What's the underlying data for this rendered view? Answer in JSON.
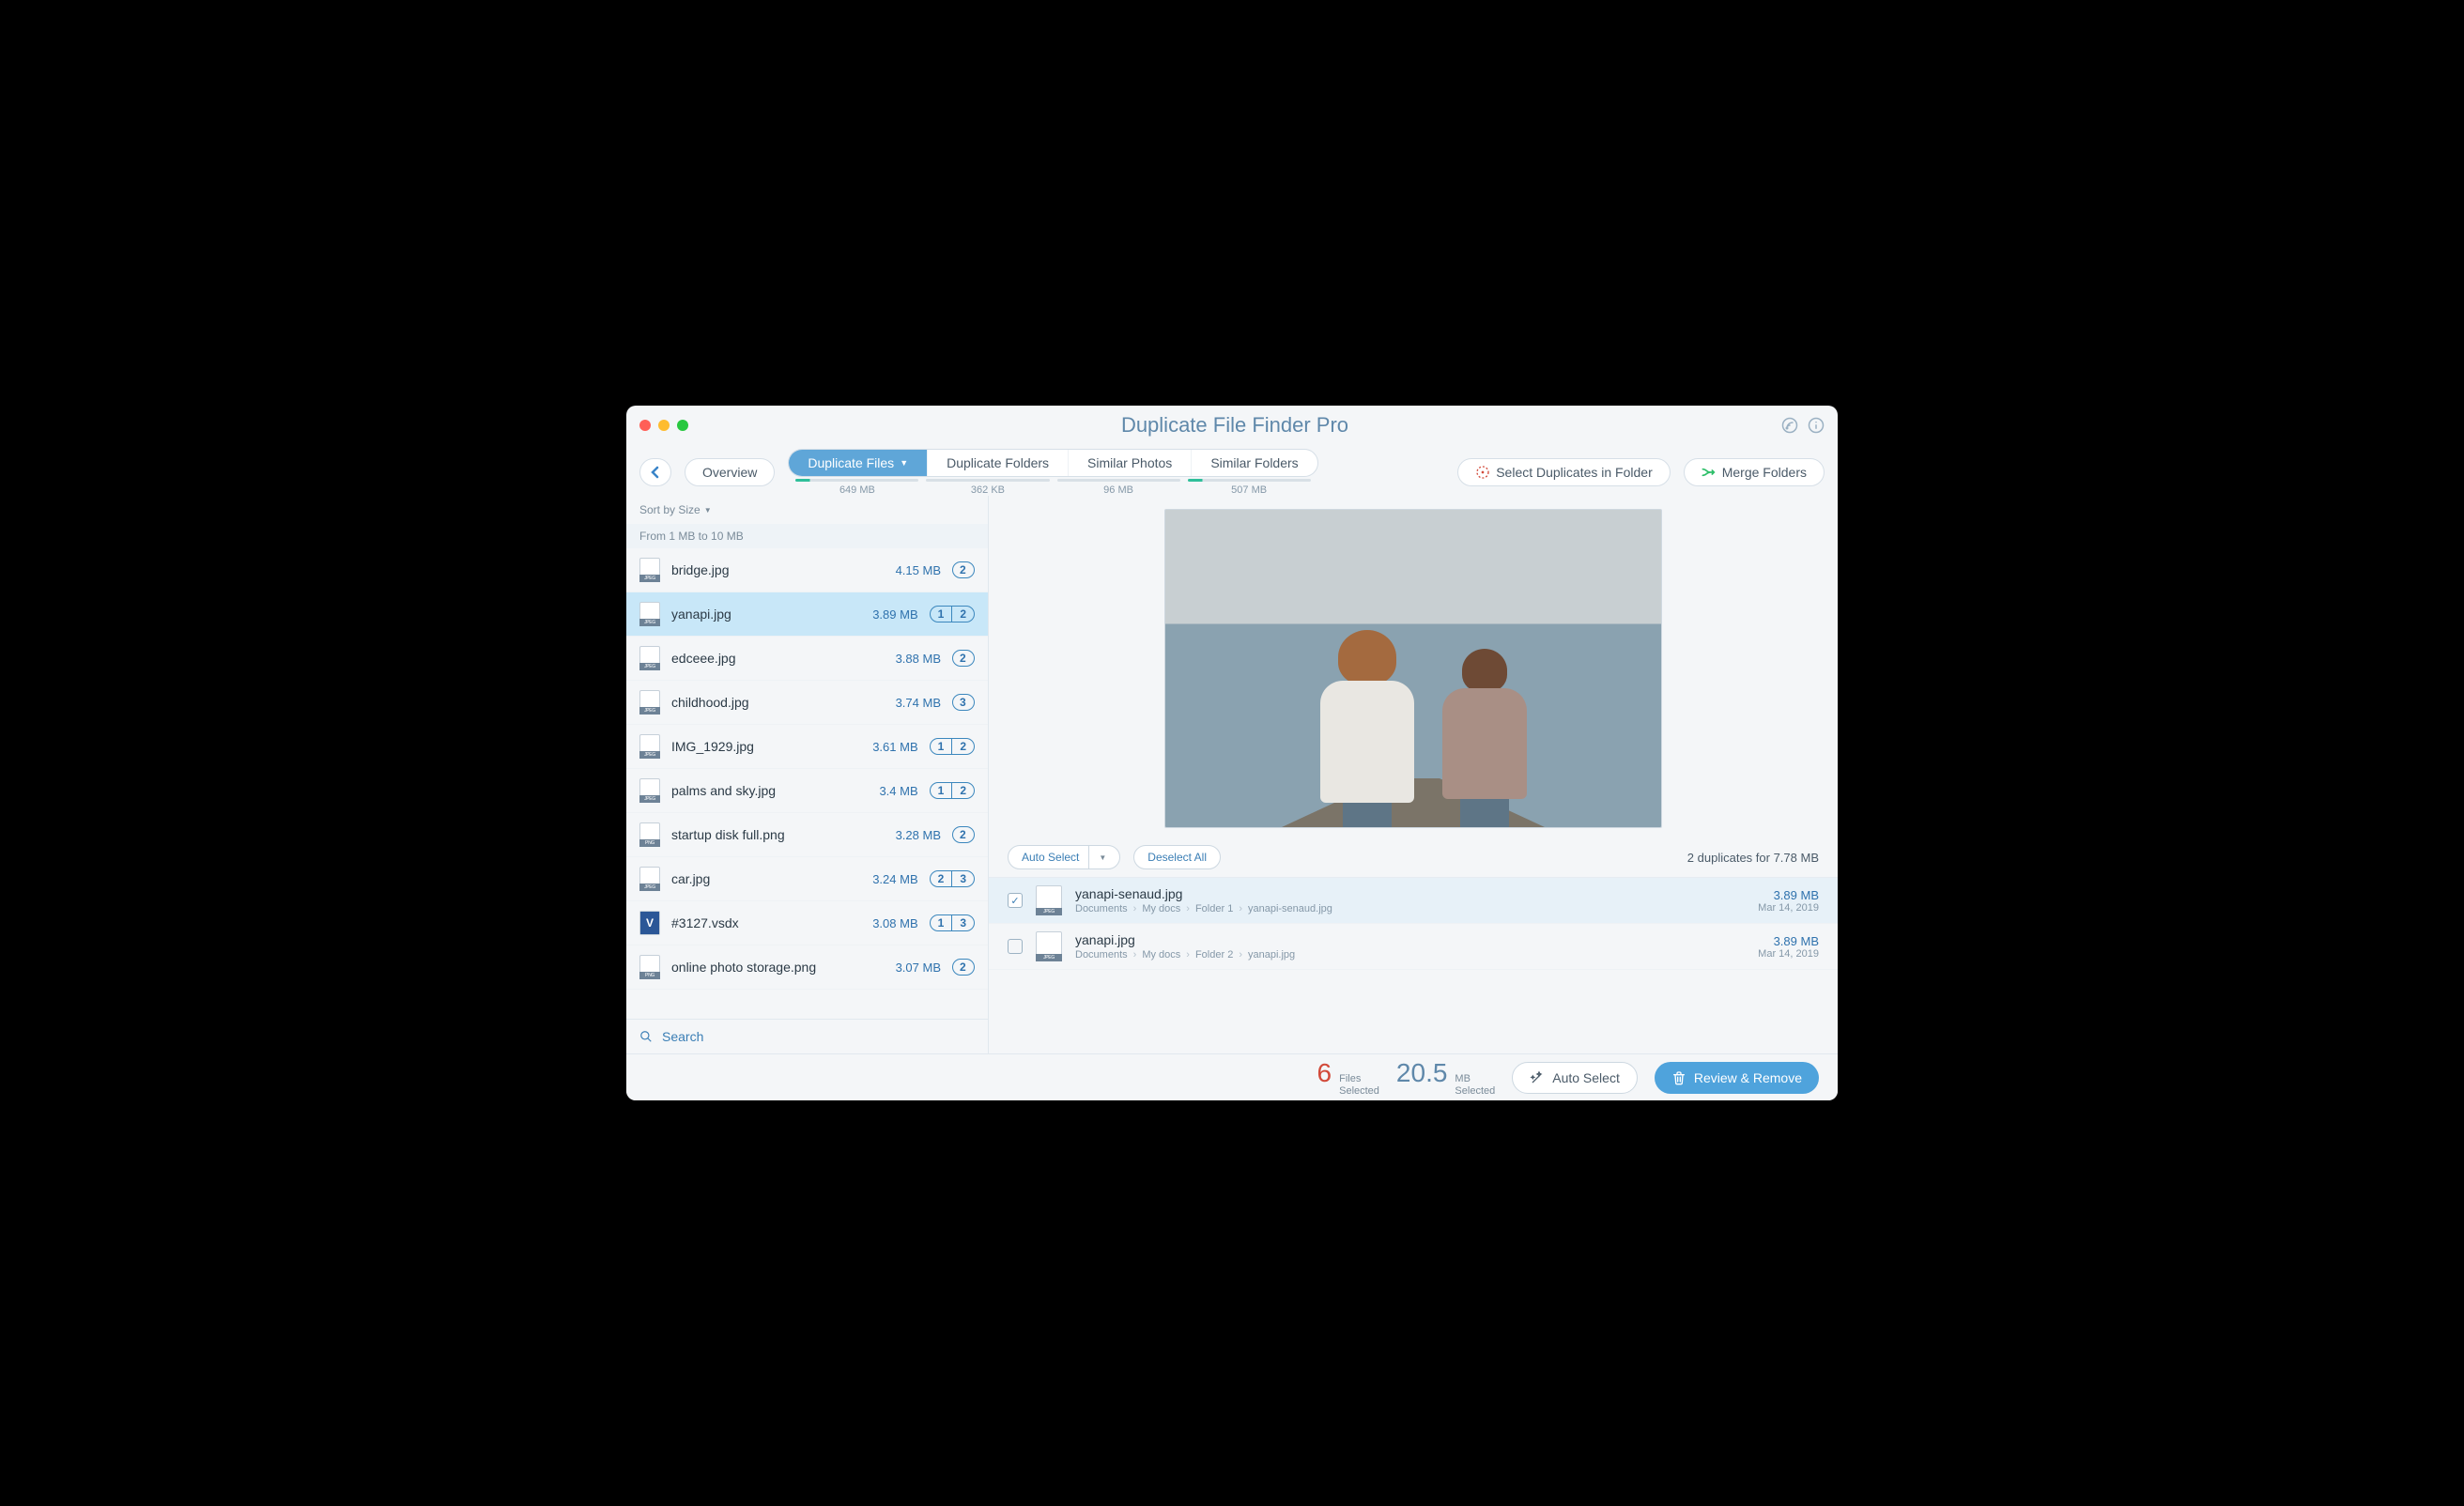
{
  "title": "Duplicate File Finder Pro",
  "toolbar": {
    "overview": "Overview",
    "tabs": [
      {
        "label": "Duplicate Files",
        "size": "649 MB",
        "active": true
      },
      {
        "label": "Duplicate Folders",
        "size": "362 KB",
        "active": false
      },
      {
        "label": "Similar Photos",
        "size": "96 MB",
        "active": false
      },
      {
        "label": "Similar Folders",
        "size": "507 MB",
        "active": false
      }
    ],
    "select_in_folder": "Select Duplicates in Folder",
    "merge_folders": "Merge Folders"
  },
  "sidebar": {
    "sort_label": "Sort by Size",
    "range_header": "From 1 MB to 10 MB",
    "files": [
      {
        "name": "bridge.jpg",
        "size": "4.15 MB",
        "badges": [
          "2"
        ],
        "type": "jpeg"
      },
      {
        "name": "yanapi.jpg",
        "size": "3.89 MB",
        "badges": [
          "1",
          "2"
        ],
        "type": "jpeg",
        "selected": true
      },
      {
        "name": "edceee.jpg",
        "size": "3.88 MB",
        "badges": [
          "2"
        ],
        "type": "jpeg"
      },
      {
        "name": "childhood.jpg",
        "size": "3.74 MB",
        "badges": [
          "3"
        ],
        "type": "jpeg"
      },
      {
        "name": "IMG_1929.jpg",
        "size": "3.61 MB",
        "badges": [
          "1",
          "2"
        ],
        "type": "jpeg"
      },
      {
        "name": "palms and sky.jpg",
        "size": "3.4 MB",
        "badges": [
          "1",
          "2"
        ],
        "type": "jpeg"
      },
      {
        "name": "startup disk full.png",
        "size": "3.28 MB",
        "badges": [
          "2"
        ],
        "type": "png"
      },
      {
        "name": "car.jpg",
        "size": "3.24 MB",
        "badges": [
          "2",
          "3"
        ],
        "type": "jpeg"
      },
      {
        "name": "#3127.vsdx",
        "size": "3.08 MB",
        "badges": [
          "1",
          "3"
        ],
        "type": "vsdx"
      },
      {
        "name": "online photo storage.png",
        "size": "3.07 MB",
        "badges": [
          "2"
        ],
        "type": "png"
      }
    ],
    "search_placeholder": "Search"
  },
  "detail": {
    "auto_select": "Auto Select",
    "deselect_all": "Deselect All",
    "summary": "2 duplicates for 7.78 MB",
    "duplicates": [
      {
        "name": "yanapi-senaud.jpg",
        "path": [
          "Documents",
          "My docs",
          "Folder 1",
          "yanapi-senaud.jpg"
        ],
        "size": "3.89 MB",
        "date": "Mar 14, 2019",
        "checked": true
      },
      {
        "name": "yanapi.jpg",
        "path": [
          "Documents",
          "My docs",
          "Folder 2",
          "yanapi.jpg"
        ],
        "size": "3.89 MB",
        "date": "Mar 14, 2019",
        "checked": false
      }
    ]
  },
  "footer": {
    "files_count": "6",
    "files_label_1": "Files",
    "files_label_2": "Selected",
    "size_count": "20.5",
    "size_label_1": "MB",
    "size_label_2": "Selected",
    "auto_select": "Auto Select",
    "review": "Review & Remove"
  }
}
